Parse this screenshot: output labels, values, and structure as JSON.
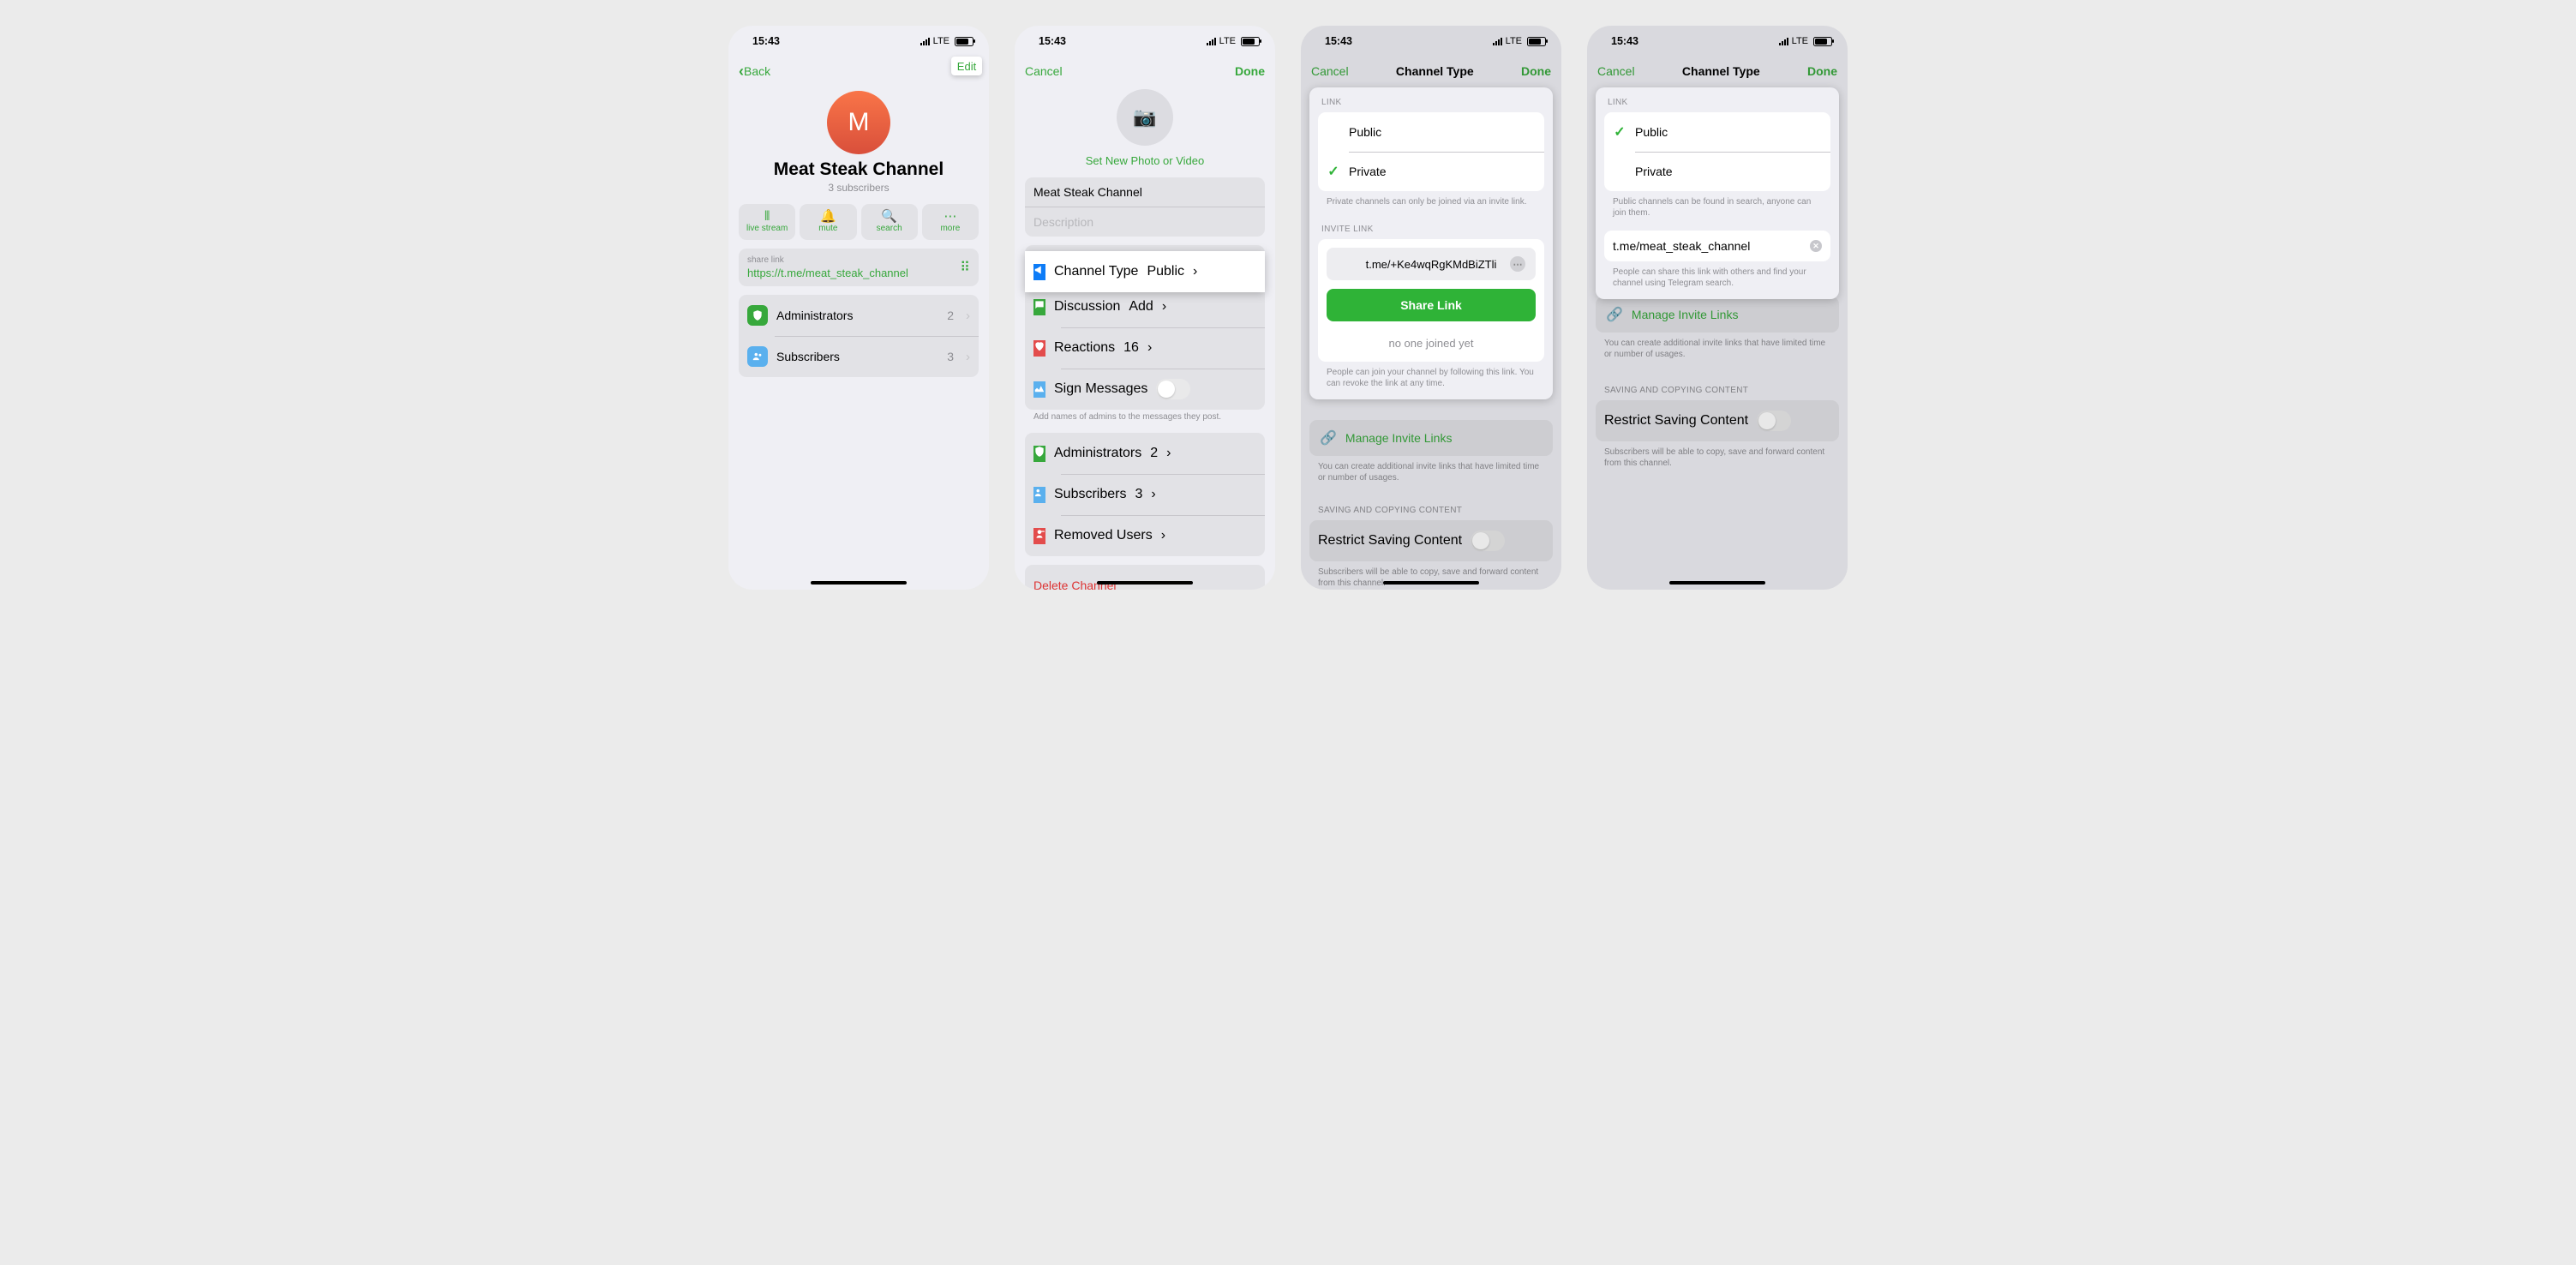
{
  "status": {
    "time": "15:43",
    "net": "LTE"
  },
  "s1": {
    "back": "Back",
    "edit": "Edit",
    "avatar_letter": "M",
    "title": "Meat Steak Channel",
    "subtitle": "3 subscribers",
    "pills": {
      "live": "live stream",
      "mute": "mute",
      "search": "search",
      "more": "more"
    },
    "share_label": "share link",
    "share_url": "https://t.me/meat_steak_channel",
    "rows": {
      "admins": {
        "label": "Administrators",
        "value": "2"
      },
      "subs": {
        "label": "Subscribers",
        "value": "3"
      }
    }
  },
  "s2": {
    "cancel": "Cancel",
    "done": "Done",
    "set_photo": "Set New Photo or Video",
    "name_value": "Meat Steak Channel",
    "desc_placeholder": "Description",
    "rows": {
      "type": {
        "label": "Channel Type",
        "value": "Public"
      },
      "disc": {
        "label": "Discussion",
        "value": "Add"
      },
      "react": {
        "label": "Reactions",
        "value": "16"
      },
      "sign": {
        "label": "Sign Messages"
      },
      "sign_footer": "Add names of admins to the messages they post.",
      "admins": {
        "label": "Administrators",
        "value": "2"
      },
      "subs": {
        "label": "Subscribers",
        "value": "3"
      },
      "removed": {
        "label": "Removed Users"
      },
      "delete": "Delete Channel"
    }
  },
  "s3": {
    "cancel": "Cancel",
    "title": "Channel Type",
    "done": "Done",
    "link_header": "LINK",
    "public": "Public",
    "private": "Private",
    "private_footer": "Private channels can only be joined via an invite link.",
    "invite_header": "INVITE LINK",
    "invite_url": "t.me/+Ke4wqRgKMdBiZTli",
    "share_btn": "Share Link",
    "noone": "no one joined yet",
    "invite_footer": "People can join your channel by following this link. You can revoke the link at any time.",
    "manage": "Manage Invite Links",
    "manage_footer": "You can create additional invite links that have limited time or number of usages.",
    "save_header": "SAVING AND COPYING CONTENT",
    "restrict_label": "Restrict Saving Content",
    "restrict_footer": "Subscribers will be able to copy, save and forward content from this channel."
  },
  "s4": {
    "cancel": "Cancel",
    "title": "Channel Type",
    "done": "Done",
    "link_header": "LINK",
    "public": "Public",
    "private": "Private",
    "public_footer": "Public channels can be found in search, anyone can join them.",
    "url_value": "t.me/meat_steak_channel",
    "url_footer": "People can share this link with others and find your channel using Telegram search.",
    "manage": "Manage Invite Links",
    "manage_footer": "You can create additional invite links that have limited time or number of usages.",
    "save_header": "SAVING AND COPYING CONTENT",
    "restrict_label": "Restrict Saving Content",
    "restrict_footer": "Subscribers will be able to copy, save and forward content from this channel."
  }
}
